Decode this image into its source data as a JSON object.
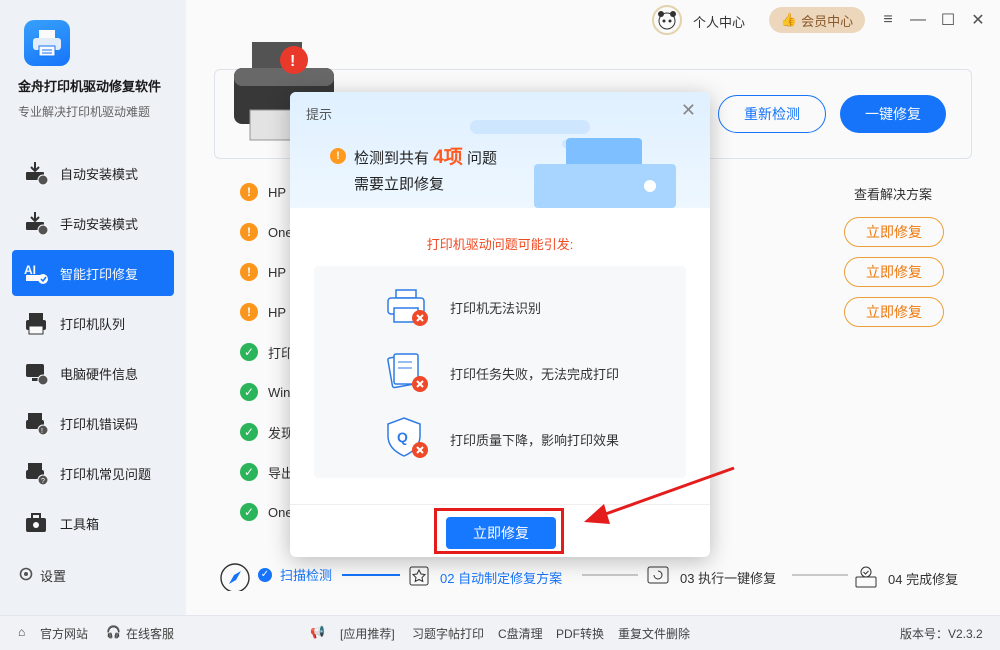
{
  "app": {
    "title": "金舟打印机驱动修复软件",
    "subtitle": "专业解决打印机驱动难题"
  },
  "sidebar": {
    "items": [
      {
        "label": "自动安装模式",
        "icon": "auto-install-icon"
      },
      {
        "label": "手动安装模式",
        "icon": "manual-install-icon"
      },
      {
        "label": "智能打印修复",
        "icon": "ai-repair-icon",
        "active": true
      },
      {
        "label": "打印机队列",
        "icon": "printer-queue-icon"
      },
      {
        "label": "电脑硬件信息",
        "icon": "hardware-info-icon"
      },
      {
        "label": "打印机错误码",
        "icon": "error-code-icon"
      },
      {
        "label": "打印机常见问题",
        "icon": "faq-icon"
      },
      {
        "label": "工具箱",
        "icon": "toolbox-icon"
      }
    ],
    "settings_label": "设置"
  },
  "titlebar": {
    "user_center": "个人中心",
    "vip_center": "会员中心"
  },
  "main": {
    "recheck_label": "重新检测",
    "fix_all_label": "一键修复",
    "solution_header": "查看解决方案",
    "issues": [
      {
        "label": "HP",
        "status": "warn",
        "fix": "立即修复"
      },
      {
        "label": "One",
        "status": "warn",
        "fix": "立即修复"
      },
      {
        "label": "HP",
        "status": "warn",
        "fix": "立即修复"
      },
      {
        "label": "HP",
        "status": "warn",
        "fix": ""
      },
      {
        "label": "打印",
        "status": "ok"
      },
      {
        "label": "Win",
        "status": "ok"
      },
      {
        "label": "发现",
        "status": "ok"
      },
      {
        "label": "导出",
        "status": "ok"
      },
      {
        "label": "One",
        "status": "ok"
      }
    ]
  },
  "steps": [
    {
      "label": "扫描检测",
      "state": "done"
    },
    {
      "label": "02 自动制定修复方案",
      "state": "current"
    },
    {
      "label": "03 执行一键修复",
      "state": "pending"
    },
    {
      "label": "04 完成修复",
      "state": "pending"
    }
  ],
  "footer": {
    "official_site": "官方网站",
    "online_service": "在线客服",
    "app_recommend": "[应用推荐]",
    "links": [
      "习题字帖打印",
      "C盘清理",
      "PDF转换",
      "重复文件删除"
    ],
    "version": "版本号：V2.3.2"
  },
  "dialog": {
    "title": "提示",
    "msg_prefix": "检测到共有",
    "count": "4项",
    "msg_suffix": "问题",
    "msg_line2": "需要立即修复",
    "cause_title": "打印机驱动问题可能引发:",
    "causes": [
      "打印机无法识别",
      "打印任务失败，无法完成打印",
      "打印质量下降，影响打印效果"
    ],
    "fix_label": "立即修复"
  },
  "colors": {
    "primary": "#1677ff",
    "warn": "#ff9a1f",
    "ok": "#2cb85c",
    "alert": "#e51c1c"
  }
}
